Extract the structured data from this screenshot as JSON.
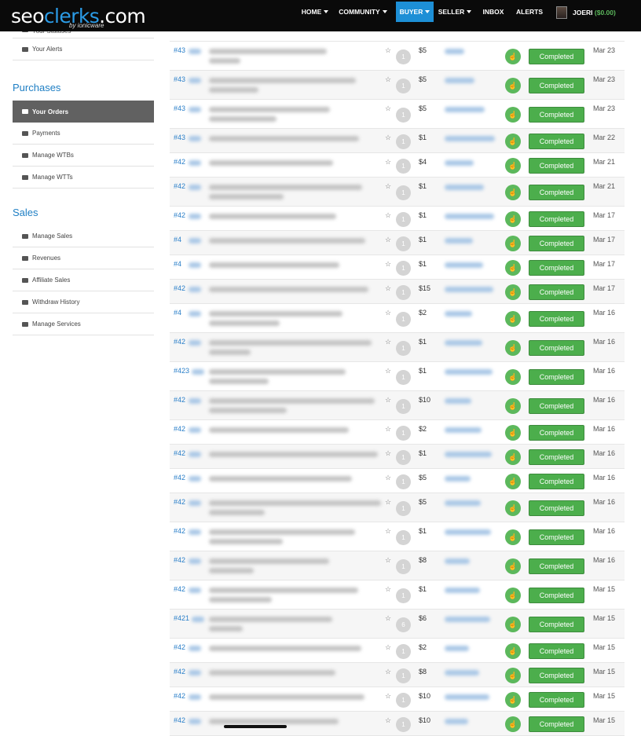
{
  "brand": {
    "logo_part1": "seo",
    "logo_part2": "clerks",
    "logo_part3": ".com",
    "byline": "by ionicware"
  },
  "nav": {
    "items": [
      {
        "label": "HOME",
        "caret": true
      },
      {
        "label": "COMMUNITY",
        "caret": true
      },
      {
        "label": "BUYER",
        "caret": true,
        "active": true
      },
      {
        "label": "SELLER",
        "caret": true
      },
      {
        "label": "INBOX",
        "caret": false
      },
      {
        "label": "ALERTS",
        "caret": false
      }
    ],
    "user": {
      "name": "JOERI",
      "balance": "($0.00)"
    }
  },
  "sidebar": {
    "top_links": [
      "Your Statuses",
      "Your Alerts"
    ],
    "purchases": {
      "heading": "Purchases",
      "items": [
        {
          "label": "Your Orders",
          "icon": "cart-icon",
          "active": true
        },
        {
          "label": "Payments",
          "icon": "card-icon"
        },
        {
          "label": "Manage WTBs",
          "icon": "external-icon"
        },
        {
          "label": "Manage WTTs",
          "icon": "list-icon"
        }
      ]
    },
    "sales": {
      "heading": "Sales",
      "items": [
        {
          "label": "Manage Sales",
          "icon": "folder-icon"
        },
        {
          "label": "Revenues",
          "icon": "money-icon"
        },
        {
          "label": "Affiliate Sales",
          "icon": "users-icon"
        },
        {
          "label": "Withdraw History",
          "icon": "doc-icon"
        },
        {
          "label": "Manage Services",
          "icon": "list-icon"
        }
      ]
    }
  },
  "orders": [
    {
      "id": "#43",
      "qty": "1",
      "price": "$5",
      "status": "Completed",
      "date": "Mar 23",
      "tall": true
    },
    {
      "id": "#43",
      "qty": "1",
      "price": "$5",
      "status": "Completed",
      "date": "Mar 23",
      "tall": true
    },
    {
      "id": "#43",
      "qty": "1",
      "price": "$5",
      "status": "Completed",
      "date": "Mar 23",
      "tall": true
    },
    {
      "id": "#43",
      "qty": "1",
      "price": "$1",
      "status": "Completed",
      "date": "Mar 22",
      "tall": false
    },
    {
      "id": "#42",
      "qty": "1",
      "price": "$4",
      "status": "Completed",
      "date": "Mar 21",
      "tall": false
    },
    {
      "id": "#42",
      "qty": "1",
      "price": "$1",
      "status": "Completed",
      "date": "Mar 21",
      "tall": true
    },
    {
      "id": "#42",
      "qty": "1",
      "price": "$1",
      "status": "Completed",
      "date": "Mar 17",
      "tall": false
    },
    {
      "id": "#4",
      "qty": "1",
      "price": "$1",
      "status": "Completed",
      "date": "Mar 17",
      "tall": false
    },
    {
      "id": "#4",
      "qty": "1",
      "price": "$1",
      "status": "Completed",
      "date": "Mar 17",
      "tall": false
    },
    {
      "id": "#42",
      "qty": "1",
      "price": "$15",
      "status": "Completed",
      "date": "Mar 17",
      "tall": false
    },
    {
      "id": "#4",
      "qty": "1",
      "price": "$2",
      "status": "Completed",
      "date": "Mar 16",
      "tall": true
    },
    {
      "id": "#42",
      "qty": "1",
      "price": "$1",
      "status": "Completed",
      "date": "Mar 16",
      "tall": true
    },
    {
      "id": "#423",
      "qty": "1",
      "price": "$1",
      "status": "Completed",
      "date": "Mar 16",
      "tall": true
    },
    {
      "id": "#42",
      "qty": "1",
      "price": "$10",
      "status": "Completed",
      "date": "Mar 16",
      "tall": true
    },
    {
      "id": "#42",
      "qty": "1",
      "price": "$2",
      "status": "Completed",
      "date": "Mar 16",
      "tall": false
    },
    {
      "id": "#42",
      "qty": "1",
      "price": "$1",
      "status": "Completed",
      "date": "Mar 16",
      "tall": false
    },
    {
      "id": "#42",
      "qty": "1",
      "price": "$5",
      "status": "Completed",
      "date": "Mar 16",
      "tall": false
    },
    {
      "id": "#42",
      "qty": "1",
      "price": "$5",
      "status": "Completed",
      "date": "Mar 16",
      "tall": true
    },
    {
      "id": "#42",
      "qty": "1",
      "price": "$1",
      "status": "Completed",
      "date": "Mar 16",
      "tall": true
    },
    {
      "id": "#42",
      "qty": "1",
      "price": "$8",
      "status": "Completed",
      "date": "Mar 16",
      "tall": true
    },
    {
      "id": "#42",
      "qty": "1",
      "price": "$1",
      "status": "Completed",
      "date": "Mar 15",
      "tall": true
    },
    {
      "id": "#421",
      "qty": "6",
      "price": "$6",
      "status": "Completed",
      "date": "Mar 15",
      "tall": true
    },
    {
      "id": "#42",
      "qty": "1",
      "price": "$2",
      "status": "Completed",
      "date": "Mar 15",
      "tall": false
    },
    {
      "id": "#42",
      "qty": "1",
      "price": "$8",
      "status": "Completed",
      "date": "Mar 15",
      "tall": false
    },
    {
      "id": "#42",
      "qty": "1",
      "price": "$10",
      "status": "Completed",
      "date": "Mar 15",
      "tall": false
    },
    {
      "id": "#42",
      "qty": "1",
      "price": "$10",
      "status": "Completed",
      "date": "Mar 15",
      "tall": false
    }
  ],
  "colors": {
    "accent": "#1d8fd6",
    "status_green": "#4cae4c",
    "link": "#2a7fc9"
  }
}
